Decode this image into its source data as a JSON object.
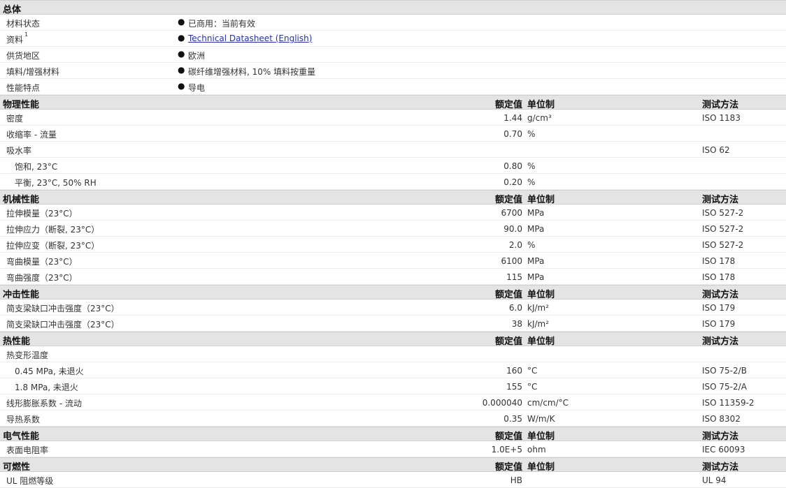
{
  "general": {
    "title": "总体",
    "rows": [
      {
        "label": "材料状态",
        "value": "已商用：当前有效"
      },
      {
        "label": "资料",
        "sup": "1",
        "link": "Technical Datasheet (English)"
      },
      {
        "label": "供货地区",
        "value": "欧洲"
      },
      {
        "label": "填料/增强材料",
        "value": "碳纤维增强材料, 10% 填料按重量"
      },
      {
        "label": "性能特点",
        "value": "导电"
      }
    ]
  },
  "col_headers": {
    "value": "额定值",
    "unit": "单位制",
    "method": "测试方法"
  },
  "sections": [
    {
      "title": "物理性能",
      "rows": [
        {
          "label": "密度",
          "value": "1.44",
          "unit": "g/cm³",
          "method": "ISO 1183"
        },
        {
          "label": "收缩率  - 流量",
          "value": "0.70",
          "unit": "%",
          "method": ""
        },
        {
          "label": "吸水率",
          "value": "",
          "unit": "",
          "method": "ISO 62"
        },
        {
          "label": "饱和, 23°C",
          "indent": true,
          "value": "0.80",
          "unit": "%",
          "method": ""
        },
        {
          "label": "平衡, 23°C, 50% RH",
          "indent": true,
          "value": "0.20",
          "unit": "%",
          "method": ""
        }
      ]
    },
    {
      "title": "机械性能",
      "rows": [
        {
          "label": "拉伸模量（23°C）",
          "value": "6700",
          "unit": "MPa",
          "method": "ISO 527-2"
        },
        {
          "label": "拉伸应力（断裂, 23°C）",
          "value": "90.0",
          "unit": "MPa",
          "method": "ISO 527-2"
        },
        {
          "label": "拉伸应变（断裂, 23°C）",
          "value": "2.0",
          "unit": "%",
          "method": "ISO 527-2"
        },
        {
          "label": "弯曲模量（23°C）",
          "value": "6100",
          "unit": "MPa",
          "method": "ISO 178"
        },
        {
          "label": "弯曲强度（23°C）",
          "value": "115",
          "unit": "MPa",
          "method": "ISO 178"
        }
      ]
    },
    {
      "title": "冲击性能",
      "rows": [
        {
          "label": "简支梁缺口冲击强度（23°C）",
          "value": "6.0",
          "unit": "kJ/m²",
          "method": "ISO 179"
        },
        {
          "label": "简支梁缺口冲击强度（23°C）",
          "value": "38",
          "unit": "kJ/m²",
          "method": "ISO 179"
        }
      ]
    },
    {
      "title": "热性能",
      "rows": [
        {
          "label": "热变形温度",
          "value": "",
          "unit": "",
          "method": ""
        },
        {
          "label": "0.45 MPa, 未退火",
          "indent": true,
          "value": "160",
          "unit": "°C",
          "method": "ISO 75-2/B"
        },
        {
          "label": "1.8 MPa, 未退火",
          "indent": true,
          "value": "155",
          "unit": "°C",
          "method": "ISO 75-2/A"
        },
        {
          "label": "线形膨胀系数  - 流动",
          "value": "0.000040",
          "unit": "cm/cm/°C",
          "method": "ISO 11359-2"
        },
        {
          "label": "导热系数",
          "value": "0.35",
          "unit": "W/m/K",
          "method": "ISO 8302"
        }
      ]
    },
    {
      "title": "电气性能",
      "rows": [
        {
          "label": "表面电阻率",
          "value": "1.0E+5",
          "unit": "ohm",
          "method": "IEC 60093"
        }
      ]
    },
    {
      "title": "可燃性",
      "rows": [
        {
          "label": "UL 阻燃等级",
          "value": "HB",
          "unit": "",
          "method": "UL 94"
        }
      ]
    }
  ]
}
